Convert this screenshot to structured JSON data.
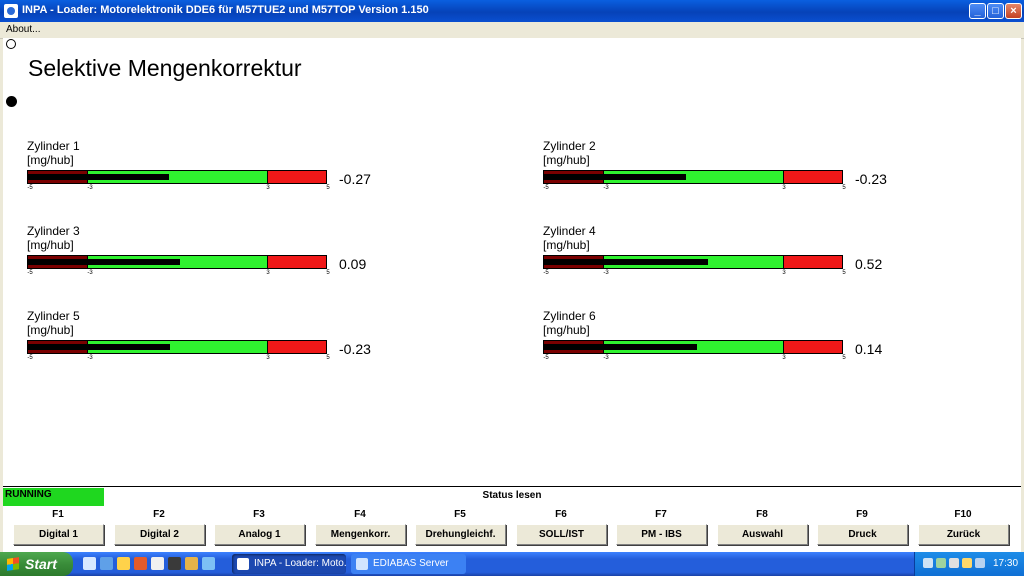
{
  "window": {
    "title": "INPA - Loader:  Motorelektronik DDE6 für M57TUE2 und M57TOP Version 1.150"
  },
  "menu": {
    "items": [
      "About..."
    ]
  },
  "screen": {
    "title": "Selektive Mengenkorrektur"
  },
  "cylinders": [
    {
      "name": "Zylinder 1",
      "unit": "[mg/hub]",
      "value": "-0.27",
      "fill_to": -0.27
    },
    {
      "name": "Zylinder 2",
      "unit": "[mg/hub]",
      "value": "-0.23",
      "fill_to": -0.23
    },
    {
      "name": "Zylinder 3",
      "unit": "[mg/hub]",
      "value": "0.09",
      "fill_to": 0.09
    },
    {
      "name": "Zylinder 4",
      "unit": "[mg/hub]",
      "value": "0.52",
      "fill_to": 0.52
    },
    {
      "name": "Zylinder 5",
      "unit": "[mg/hub]",
      "value": "-0.23",
      "fill_to": -0.23
    },
    {
      "name": "Zylinder 6",
      "unit": "[mg/hub]",
      "value": "0.14",
      "fill_to": 0.14
    }
  ],
  "gauge": {
    "min": -5,
    "max": 5,
    "low_limit": -3,
    "high_limit": 3,
    "ticks": [
      "-5",
      "-3",
      "3",
      "5"
    ]
  },
  "status": {
    "state": "RUNNING",
    "label": "Status lesen"
  },
  "function_keys": [
    {
      "key": "F1",
      "label": "Digital 1"
    },
    {
      "key": "F2",
      "label": "Digital 2"
    },
    {
      "key": "F3",
      "label": "Analog 1"
    },
    {
      "key": "F4",
      "label": "Mengenkorr."
    },
    {
      "key": "F5",
      "label": "Drehungleichf."
    },
    {
      "key": "F6",
      "label": "SOLL/IST"
    },
    {
      "key": "F7",
      "label": "PM - IBS"
    },
    {
      "key": "F8",
      "label": "Auswahl"
    },
    {
      "key": "F9",
      "label": "Druck"
    },
    {
      "key": "F10",
      "label": "Zurück"
    }
  ],
  "taskbar": {
    "start": "Start",
    "tasks": [
      "INPA - Loader:  Moto...",
      "EDIABAS Server"
    ],
    "clock": "17:30"
  },
  "colors": {
    "ok": "#2ff22f",
    "low": "#7a0000",
    "high": "#f01818",
    "running": "#1fd71f"
  }
}
